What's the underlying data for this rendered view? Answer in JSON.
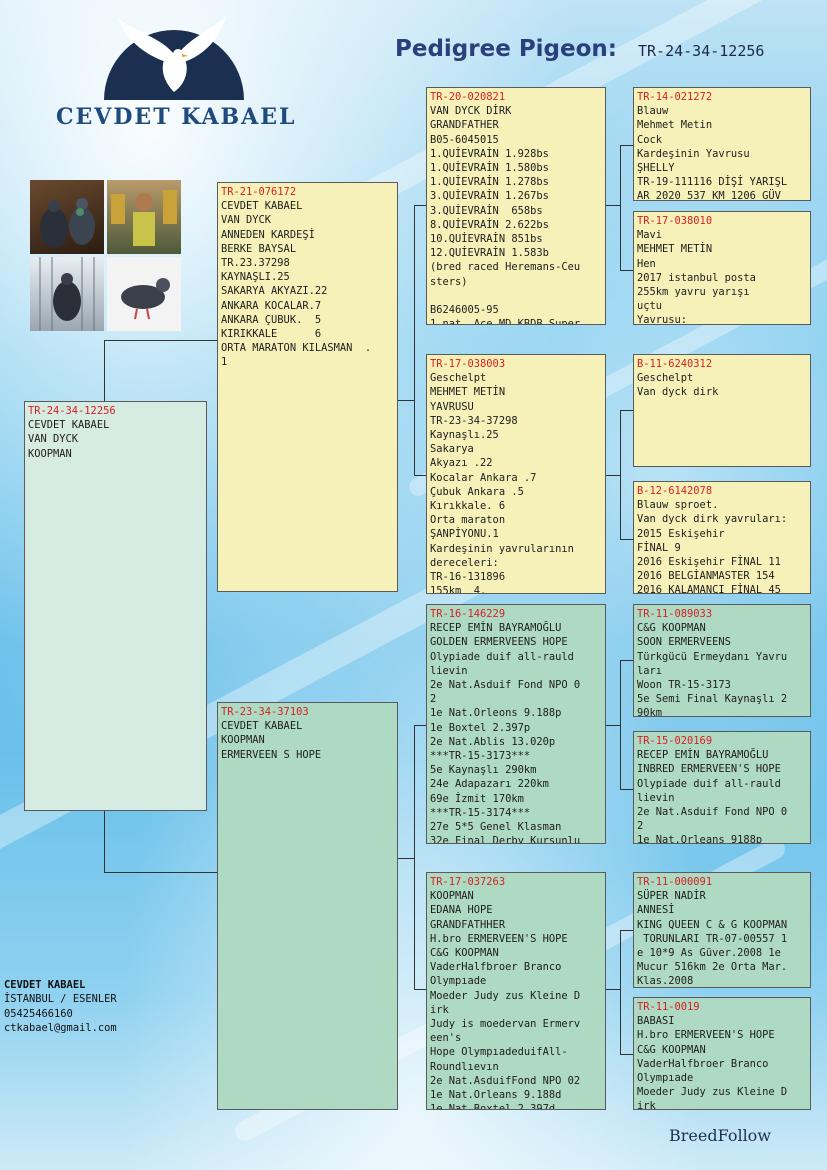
{
  "breeder_logo": {
    "name": "CEVDET KABAEL"
  },
  "header": {
    "title": "Pedigree Pigeon:",
    "ring_id": "TR-24-34-12256"
  },
  "photos": [
    "pigeon-pair-photo",
    "breeder-with-trophies-photo",
    "pigeon-in-loft-photo",
    "pigeon-portrait-photo"
  ],
  "subject": {
    "ring": "TR-24-34-12256",
    "text": "CEVDET KABAEL\nVAN DYCK\nKOOPMAN"
  },
  "sire": {
    "ring": "TR-21-076172",
    "text": "CEVDET KABAEL\nVAN DYCK\nANNEDEN KARDEŞİ\nBERKE BAYSAL\nTR.23.37298\nKAYNAŞLI.25\nSAKARYA AKYAZI.22\nANKARA KOCALAR.7\nANKARA ÇUBUK.  5\nKIRIKKALE      6\nORTA MARATON KILASMAN  .\n1"
  },
  "dam": {
    "ring": "TR-23-34-37103",
    "text": "CEVDET KABAEL\nKOOPMAN\nERMERVEEN S HOPE"
  },
  "sire_sire": {
    "ring": "TR-20-020821",
    "text": "VAN DYCK DİRK\nGRANDFATHER\nB05-6045015\n1.QUİEVRAİN 1.928bs\n1.QUİEVRAİN 1.580bs\n1.QUİEVRAİN 1.278bs\n3.QUİEVRAİN 1.267bs\n3.QUİEVRAİN  658bs\n8.QUİEVRAİN 2.622bs\n10.QUİEVRAİN 851bs\n12.QUİEVRAİN 1.583b\n(bred raced Heremans-Ceu\nsters)\n\nB6246005-95\n1 nat. Ace MD KBDB Super"
  },
  "sire_dam": {
    "ring": "TR-17-038003",
    "text": "Geschelpt\nMEHMET METİN\nYAVRUSU\nTR-23-34-37298\nKaynaşlı.25\nSakarya\nAkyazı .22\nKocalar Ankara .7\nÇubuk Ankara .5\nKırıkkale. 6\nOrta maraton\nŞANPİYONU.1\nKardeşinin yavrularının\ndereceleri:\nTR-16-131896\n155km  4."
  },
  "dam_sire": {
    "ring": "TR-16-146229",
    "text": "RECEP EMİN BAYRAMOĞLU\nGOLDEN ERMERVEENS HOPE\nOlypiade duif all-rauld\nlievin\n2e Nat.Asduif Fond NPO 0\n2\n1e Nat.Orleons 9.188p\n1e Boxtel 2.397p\n2e Nat.Ablis 13.020p\n***TR-15-3173***\n5e Kaynaşlı 290km\n24e Adapazarı 220km\n69e İzmit 170km\n***TR-15-3174***\n27e 5*5 Genel Klasman\n32e Final Derby Kurşunlu"
  },
  "dam_dam": {
    "ring": "TR-17-037263",
    "text": "KOOPMAN\nEDANA HOPE\nGRANDFATHHER\nH.bro ERMERVEEN'S HOPE\nC&G KOOPMAN\nVaderHalfbroer Branco\nOlympıade\nMoeder Judy zus Kleine D\nirk\nJudy is moedervan Ermerv\neen's\nHope OlympıadeduifAll-\nRoundlıevın\n2e Nat.AsduifFond NPO 02\n1e Nat.Orleans 9.188d\n1e Nat.Boxtel 2.397d"
  },
  "ss_sire": {
    "ring": "TR-14-021272",
    "text": "Blauw\nMehmet Metin\nCock\nKardeşinin Yavrusu\nŞHELLY\nTR-19-111116 DİŞİ YARIŞL\nAR 2020 537 KM 1206 GÜV"
  },
  "ss_dam": {
    "ring": "TR-17-038010",
    "text": "Mavi\nMEHMET METİN\nHen\n2017 istanbul posta\n255km yavru yarışı\nuçtu\nYavrusu:"
  },
  "sd_sire": {
    "ring": "B-11-6240312",
    "text": "Geschelpt\nVan dyck dirk"
  },
  "sd_dam": {
    "ring": "B-12-6142078",
    "text": "Blauw sproet.\nVan dyck dirk yavruları:\n2015 Eskişehir\nFİNAL 9\n2016 Eskişehir FİNAL 11\n2016 BELGİANMASTER 154\n2016 KALAMANCI FİNAL 45"
  },
  "ds_sire": {
    "ring": "TR-11-089033",
    "text": "C&G KOOPMAN\nSOON ERMERVEENS\nTürkgücü Ermeydanı Yavru\nları\nWoon TR-15-3173\n5e Semi Final Kaynaşlı 2\n90km"
  },
  "ds_dam": {
    "ring": "TR-15-020169",
    "text": "RECEP EMİN BAYRAMOĞLU\nINBRED ERMERVEEN'S HOPE\nOlypiade duif all-rauld\nlievin\n2e Nat.Asduif Fond NPO 0\n2\n1e Nat.Orleans 9188p"
  },
  "dd_sire": {
    "ring": "TR-11-000091",
    "text": "SÜPER NADİR\nANNESİ\nKING QUEEN C & G KOOPMAN\n TORUNLARI TR-07-00557 1\ne 10*9 As Güver.2008 1e\nMucur 516km 2e Orta Mar.\nKlas.2008"
  },
  "dd_dam": {
    "ring": "TR-11-0019",
    "text": "BABASI\nH.bro ERMERVEEN'S HOPE\nC&G KOOPMAN\nVaderHalfbroer Branco\nOlympıade\nMoeder Judy zus Kleine D\nirk"
  },
  "contact": {
    "name": "CEVDET KABAEL",
    "location": "İSTANBUL / ESENLER",
    "phone": "05425466160",
    "email": "ctkabael@gmail.com"
  },
  "footer": {
    "brand": "BreedFollow"
  }
}
